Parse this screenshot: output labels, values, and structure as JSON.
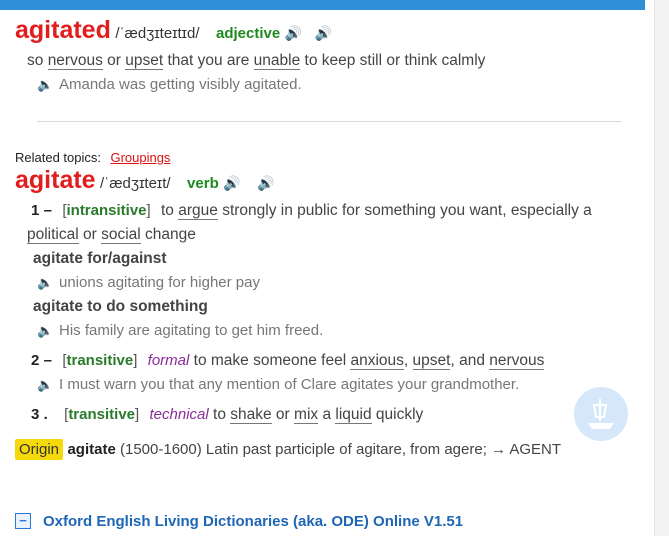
{
  "entry1": {
    "headword": "agitated",
    "pron": "/ˈædʒɪteɪtɪd/",
    "pos": "adjective",
    "definition_parts": [
      "so ",
      "nervous",
      " or ",
      "upset",
      " that you are ",
      "unable",
      " to keep still or think calmly"
    ],
    "example": "Amanda was getting visibly agitated."
  },
  "related": {
    "label": "Related topics:",
    "link": "Groupings"
  },
  "entry2": {
    "headword": "agitate",
    "pron": "/ˈædʒɪteɪt/",
    "pos": "verb",
    "sense1": {
      "num": "1",
      "dash": "–",
      "gram": "intransitive",
      "def_line1_parts": [
        "to ",
        "argue",
        " strongly in public for something you want, especially a"
      ],
      "def_line2_parts": [
        "political",
        " or ",
        "social",
        " change"
      ],
      "phrase1": "agitate for/against",
      "example1": "unions agitating for higher pay",
      "phrase2": "agitate to do something",
      "example2": "His family are agitating to get him freed."
    },
    "sense2": {
      "num": "2",
      "dash": "–",
      "gram": "transitive",
      "register": "formal",
      "def_parts": [
        " to make someone feel ",
        "anxious",
        ", ",
        "upset",
        ", and ",
        "nervous"
      ],
      "example": "I must warn you that any mention of Clare agitates your grandmother."
    },
    "sense3": {
      "num": "3",
      "dot": ".",
      "gram": "transitive",
      "register": "technical",
      "def_parts": [
        " to ",
        "shake",
        " or ",
        "mix",
        " a ",
        "liquid",
        " quickly"
      ]
    },
    "origin": {
      "badge": "Origin",
      "word": "agitate",
      "text": " (1500-1600) Latin past participle of agitare, from agere; → AGENT"
    }
  },
  "footer": {
    "toggle": "−",
    "dictionary": "Oxford English Living Dictionaries (aka. ODE) Online V1.51"
  },
  "icons": {
    "speaker": "speaker-icon",
    "logo": "ship-logo-icon"
  },
  "colors": {
    "headword": "#e11d1d",
    "pos": "#1e8a1e",
    "link": "#1f66b7",
    "origin_badge": "#f5d90a",
    "topbar": "#2f8fd8"
  }
}
